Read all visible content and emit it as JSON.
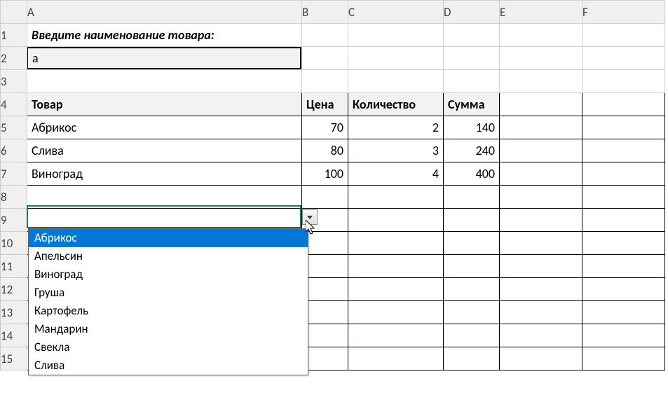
{
  "columns": [
    "A",
    "B",
    "C",
    "D",
    "E",
    "F"
  ],
  "rows": [
    "1",
    "2",
    "3",
    "4",
    "5",
    "6",
    "7",
    "8",
    "9",
    "10",
    "11",
    "12",
    "13",
    "14",
    "15"
  ],
  "cells": {
    "A1": "Введите наименование товара:",
    "A2": "а",
    "A4": "Товар",
    "B4": "Цена",
    "C4": "Количество",
    "D4": "Сумма",
    "A5": "Абрикос",
    "B5": "70",
    "C5": "2",
    "D5": "140",
    "A6": "Слива",
    "B6": "80",
    "C6": "3",
    "D6": "240",
    "A7": "Виноград",
    "B7": "100",
    "C7": "4",
    "D7": "400"
  },
  "dropdown": {
    "items": [
      "Абрикос",
      "Апельсин",
      "Виноград",
      "Груша",
      "Картофель",
      "Мандарин",
      "Свекла",
      "Слива"
    ],
    "selectedIndex": 0
  }
}
